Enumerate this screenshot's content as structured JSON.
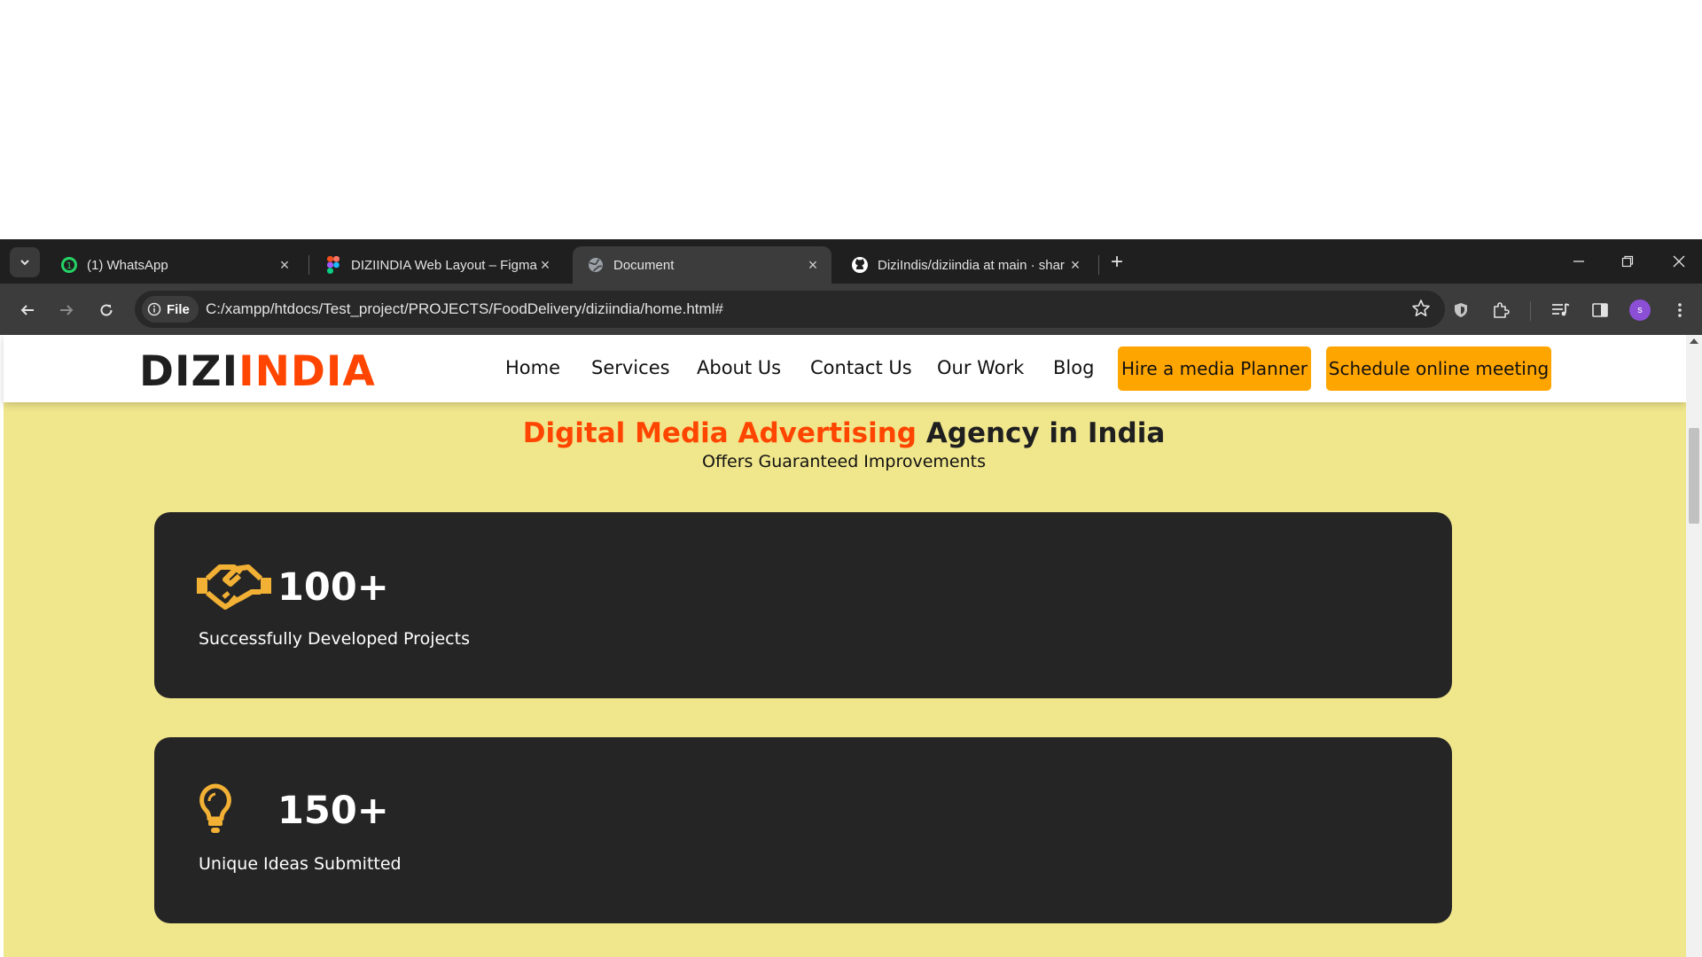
{
  "browser": {
    "tabs": [
      {
        "title": "(1) WhatsApp",
        "favicon": "whatsapp-icon",
        "active": false
      },
      {
        "title": "DIZIINDIA Web Layout – Figma",
        "favicon": "figma-icon",
        "active": false
      },
      {
        "title": "Document",
        "favicon": "globe-icon",
        "active": true
      },
      {
        "title": "DiziIndis/diziindia at main · shar",
        "favicon": "github-icon",
        "active": false
      }
    ],
    "close_glyph": "×",
    "new_tab_glyph": "+",
    "address": {
      "chip_label": "File",
      "url": "C:/xampp/htdocs/Test_project/PROJECTS/FoodDelivery/diziindia/home.html#"
    },
    "profile_initial": "s"
  },
  "site": {
    "logo": {
      "part1": "DIZI",
      "part2": "INDIA"
    },
    "nav": [
      "Home",
      "Services",
      "About Us",
      "Contact Us",
      "Our Work",
      "Blog"
    ],
    "cta_buttons": [
      "Hire a media Planner",
      "Schedule online meeting"
    ],
    "hero": {
      "headline_highlight": "Digital Media Advertising",
      "headline_rest": " Agency in India",
      "subheadline": "Offers Guaranteed Improvements"
    },
    "stats": [
      {
        "value": "100+",
        "label": "Successfully Developed Projects",
        "icon": "handshake-icon"
      },
      {
        "value": "150+",
        "label": "Unique Ideas Submitted",
        "icon": "lightbulb-icon"
      }
    ]
  },
  "colors": {
    "brand_orange": "#ff4500",
    "cta_orange": "#ffa500",
    "page_background": "#f0e68c",
    "card_background": "#252525",
    "icon_gold": "#f2b134"
  }
}
